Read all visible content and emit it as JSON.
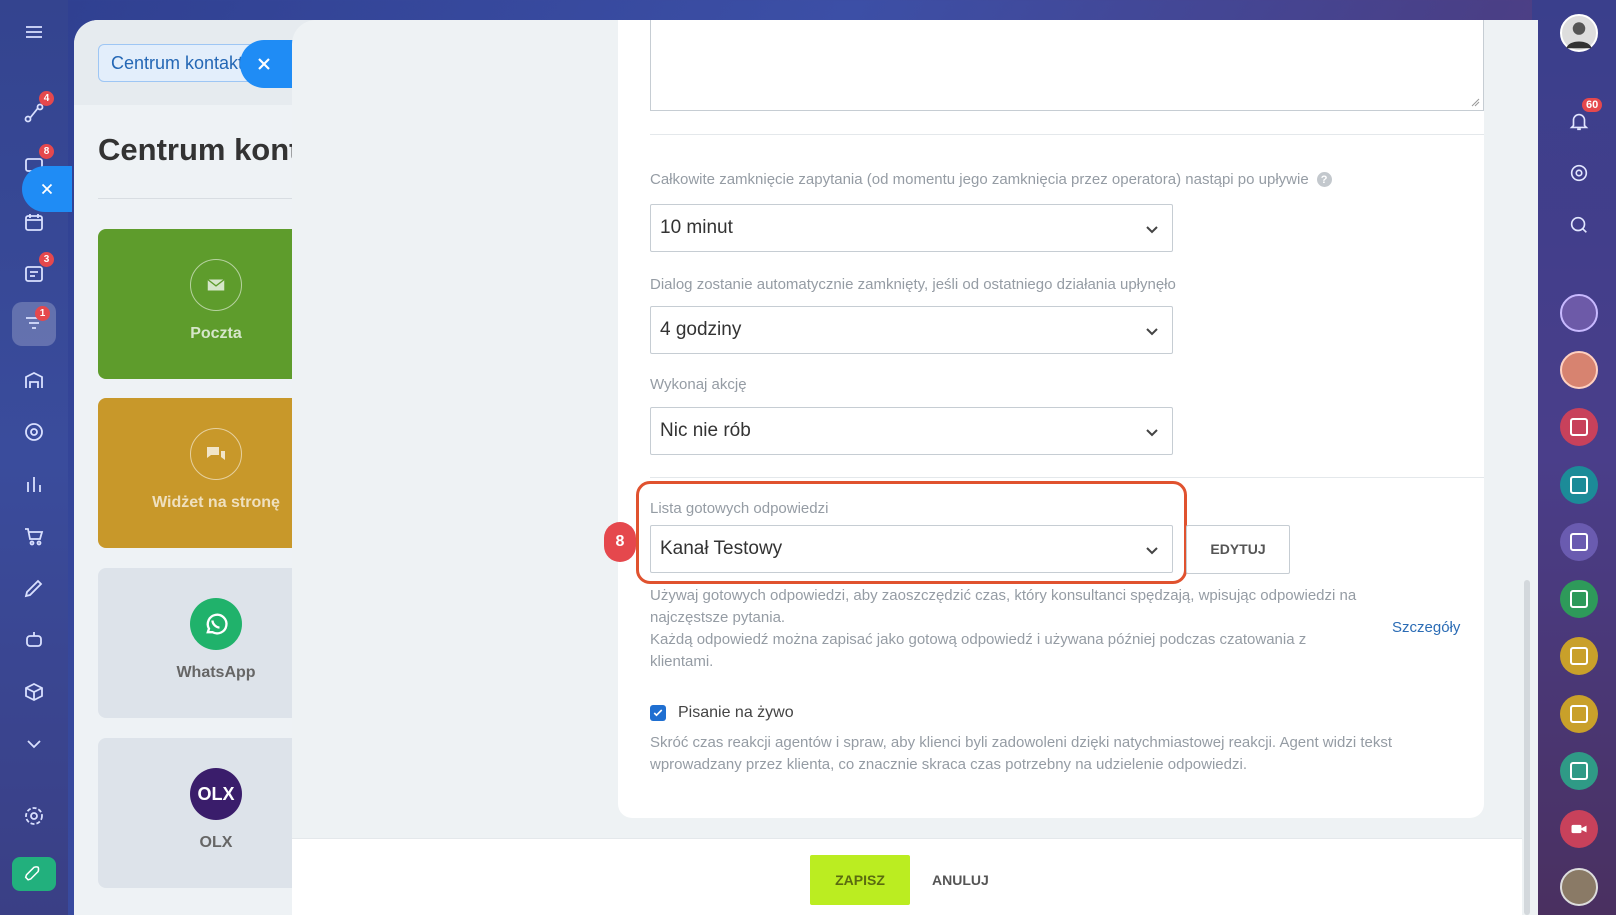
{
  "background": {
    "tab_label": "Centrum kontaktowe",
    "page_title": "Centrum kontaktowe",
    "tiles": [
      {
        "label": "Poczta",
        "icon": "mail-icon"
      },
      {
        "label": "Widżet na stronę",
        "icon": "chat-bubbles-icon"
      },
      {
        "label": "WhatsApp",
        "icon": "whatsapp-icon"
      },
      {
        "label": "OLX",
        "icon": "olx-logo"
      }
    ],
    "olx_logo_text": "OLX"
  },
  "left_nav": {
    "badges": {
      "item1": "4",
      "item2": "8",
      "item4": "3",
      "item5": "1"
    }
  },
  "right_rail": {
    "notifications_badge": "60"
  },
  "form": {
    "close_label": "Całkowite zamknięcie zapytania (od momentu jego zamknięcia przez operatora) nastąpi po upływie",
    "close_value": "10 minut",
    "auto_close_label": "Dialog zostanie automatycznie zamknięty, jeśli od ostatniego działania upłynęło",
    "auto_close_value": "4 godziny",
    "action_label": "Wykonaj akcję",
    "action_value": "Nic nie rób",
    "answers_label": "Lista gotowych odpowiedzi",
    "answers_value": "Kanał Testowy",
    "edit_button": "EDYTUJ",
    "step_marker": "8",
    "answers_desc_1": "Używaj gotowych odpowiedzi, aby zaoszczędzić czas, który konsultanci spędzają, wpisując odpowiedzi na najczęstsze pytania.",
    "answers_desc_2": "Każdą odpowiedź można zapisać jako gotową odpowiedź i używana później podczas czatowania z klientami.",
    "details_link": "Szczegóły",
    "live_typing_label": "Pisanie na żywo",
    "live_typing_checked": true,
    "live_typing_desc": "Skróć czas reakcji agentów i spraw, aby klienci byli zadowoleni dzięki natychmiastowej reakcji. Agent widzi tekst wprowadzany przez klienta, co znacznie skraca czas potrzebny na udzielenie odpowiedzi."
  },
  "footer": {
    "save_button": "ZAPISZ",
    "cancel_button": "ANULUJ"
  },
  "colors": {
    "accent_blue": "#1f8cf5",
    "save_green": "#bbed21",
    "highlight_orange": "#e0522f",
    "badge_red": "#e5484d"
  }
}
